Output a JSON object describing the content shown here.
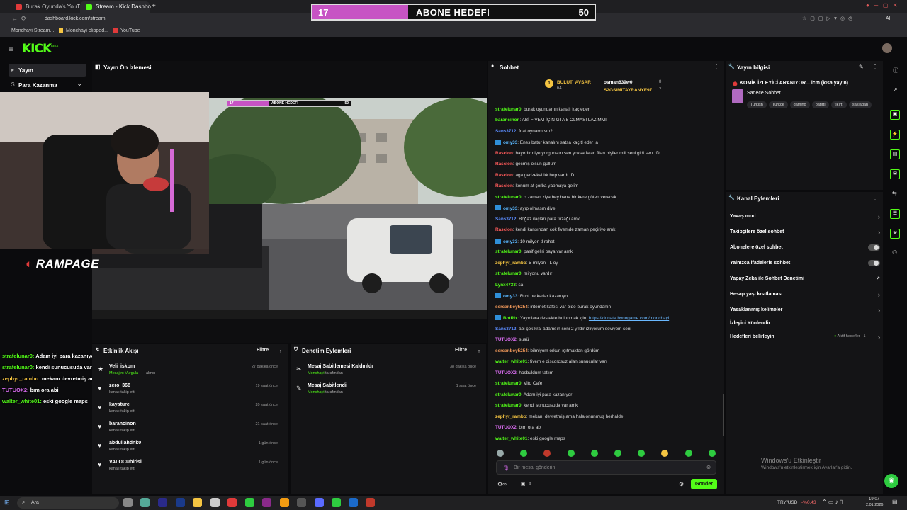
{
  "browser": {
    "tabs": [
      {
        "label": "Burak Oyunda's YouTube",
        "color": "#e03a3a"
      },
      {
        "label": "Stream - Kick Dashbo",
        "color": "#53fc18"
      }
    ],
    "new_tab": "+",
    "url": "dashboard.kick.com/stream",
    "bookmarks": [
      "Monchayi Stream...",
      "Monchayi clipped...",
      "YouTube"
    ],
    "ai_label": "AI"
  },
  "goal": {
    "current": "17",
    "label": "ABONE HEDEFI",
    "target": "50",
    "progress": 0.34,
    "color": "#c753c4"
  },
  "kick": {
    "logo": "KICK",
    "beta": "BETA"
  },
  "leftnav": {
    "items": [
      {
        "label": "Yayın"
      },
      {
        "label": "Para Kazanma"
      }
    ]
  },
  "preview": {
    "title": "Yayın Ön İzlemesi",
    "inner_goal": {
      "current": "17",
      "label": "ABONE HEDEFI",
      "target": "50"
    },
    "overlay_logo": "RAMPAGE",
    "overlay_chat": [
      {
        "user": "strafelunar0:",
        "msg": "Adam iyi para kazanıyor",
        "color": "#53fc18"
      },
      {
        "user": "strafelunar0:",
        "msg": "kendi sunucusuda var amk",
        "color": "#53fc18"
      },
      {
        "user": "zephyr_rambo:",
        "msg": "mekanı devretmiş ama hala onunmuş herhalde",
        "color": "#f5c542"
      },
      {
        "user": "TUTUOX2:",
        "msg": "bım ora abi",
        "color": "#d96cf0"
      },
      {
        "user": "walter_white01:",
        "msg": "eski google maps",
        "color": "#53fc18"
      }
    ]
  },
  "activity": {
    "title": "Etkinlik Akışı",
    "filter": "Filtre",
    "events": [
      {
        "name": "Veli_iskom",
        "sub": "Mesajını Vurgula",
        "sub2": "almdı",
        "time": "27 dakika önce"
      },
      {
        "name": "zero_368",
        "sub": "kanalı takip etti",
        "time": "19 saat önce"
      },
      {
        "name": "kayature",
        "sub": "kanalı takip etti",
        "time": "20 saat önce"
      },
      {
        "name": "barancinon",
        "sub": "kanalı takip etti",
        "time": "21 saat önce"
      },
      {
        "name": "abdullahdnk0",
        "sub": "kanalı takip etti",
        "time": "1 gün önce"
      },
      {
        "name": "VALOCUbirisi",
        "sub": "kanalı takip etti",
        "time": "1 gün önce"
      }
    ]
  },
  "moderation": {
    "title": "Denetim Eylemleri",
    "filter": "Filtre",
    "actions": [
      {
        "title": "Mesaj Sabitlemesi Kaldırıldı",
        "by": "Monchayi",
        "by_suffix": "tarafından",
        "time": "38 dakika önce"
      },
      {
        "title": "Mesaj Sabitlendi",
        "by": "Monchayi",
        "by_suffix": "tarafından",
        "time": "1 saat önce"
      }
    ]
  },
  "chat": {
    "title": "Sohbet",
    "top_users": [
      {
        "name": "BULUT_AVSAR",
        "count": "64"
      },
      {
        "name": "osman639w0",
        "count": "8"
      },
      {
        "name": "S2GSIMITAYRANYE97",
        "count": "7"
      }
    ],
    "messages": [
      {
        "user": "strafelunar0",
        "text": "burak oyundanın kanalı kaç eder",
        "color": "#53fc18"
      },
      {
        "user": "barancinon",
        "text": "ABİ FİVEM İÇİN GTA 5 OLMASI LAZIMMI",
        "color": "#53fc18"
      },
      {
        "user": "Sans3712",
        "text": "fnaf oynarmısın?",
        "color": "#5b8cff"
      },
      {
        "user": "omy33",
        "text": "Enes batur kanalını satsa kaç tl eder la",
        "color": "#5bb8ff",
        "badge": true
      },
      {
        "user": "Rasclon",
        "text": "hayırdır niye yorgunsun sen yoksa falan filan bişiler mili seni gidi seni :D",
        "color": "#ff5b5b"
      },
      {
        "user": "Rasclon",
        "text": "geçmiş olsun güllüm",
        "color": "#ff5b5b"
      },
      {
        "user": "Rasclon",
        "text": "aga gerizekalılık hep vardı :D",
        "color": "#ff5b5b"
      },
      {
        "user": "Rasclon",
        "text": "konum at çorba yapmaya gelim",
        "color": "#ff5b5b"
      },
      {
        "user": "strafelunar0",
        "text": "o zaman ziya bey bana bir kere göten verecek",
        "color": "#53fc18"
      },
      {
        "user": "omy33",
        "text": "ayıp olmasın diye",
        "color": "#5bb8ff",
        "badge": true
      },
      {
        "user": "Sans3712",
        "text": "Boğaz ilaçları para tuzağı amk",
        "color": "#5b8cff"
      },
      {
        "user": "Rasclon",
        "text": "kendi kansından cok fivemde zaman geçiriyo amk",
        "color": "#ff5b5b"
      },
      {
        "user": "omy33",
        "text": "10 milyon tl rahat",
        "color": "#5bb8ff",
        "badge": true
      },
      {
        "user": "strafelunar0",
        "text": "pasif geliri baya var amk",
        "color": "#53fc18"
      },
      {
        "user": "zephyr_rambo",
        "text": "5 milyon TL oy",
        "color": "#f5c542"
      },
      {
        "user": "strafelunar0",
        "text": "milyonu vardır",
        "color": "#53fc18"
      },
      {
        "user": "Lynx4733",
        "text": "sa",
        "color": "#53fc18"
      },
      {
        "user": "omy33",
        "text": "Ruhi ne kadar kazanıyo",
        "color": "#5bb8ff",
        "badge": true
      },
      {
        "user": "sercanbey5254",
        "text": "internet kafesi var bide burak oyundanın",
        "color": "#f29a5b"
      },
      {
        "user": "BotRix",
        "text": "Yayınlara destekte bulunmak için: ",
        "link": "https://donate.bynogame.com/monchayi",
        "color": "#53fc18",
        "badge": true
      },
      {
        "user": "Sans3712",
        "text": "abi çok kral adamsın seni 2 yıldır izliyorum seviyom seni",
        "color": "#5b8cff"
      },
      {
        "user": "TUTUOX2",
        "text": "suaü",
        "color": "#d96cf0"
      },
      {
        "user": "sercanbey5254",
        "text": "bilmiyom orkun ışıtmaktan gördüm",
        "color": "#f29a5b"
      },
      {
        "user": "walter_white01",
        "text": "fivem e discordsuz alan sunucular varı",
        "color": "#53fc18"
      },
      {
        "user": "TUTUOX2",
        "text": "hosbuldum tatlım",
        "color": "#d96cf0"
      },
      {
        "user": "strafelunar0",
        "text": "Vito Cafe",
        "color": "#53fc18"
      },
      {
        "user": "strafelunar0",
        "text": "Adam iyi para kazanıyor",
        "color": "#53fc18"
      },
      {
        "user": "strafelunar0",
        "text": "kendi sunucusuda var amk",
        "color": "#53fc18"
      },
      {
        "user": "zephyr_rambo",
        "text": "mekanı devretmiş ama hala onunmuş herhalde",
        "color": "#f5c542"
      },
      {
        "user": "TUTUOX2",
        "text": "bım ora abi",
        "color": "#d96cf0"
      },
      {
        "user": "walter_white01",
        "text": "eski google maps",
        "color": "#53fc18"
      }
    ],
    "input_placeholder": "Bir mesaj gönderin",
    "count": "0",
    "send_label": "Gönder"
  },
  "stream_info": {
    "title": "Yayın bilgisi",
    "stream_title": "KOMİK İZLEYİCİ ARANIYOR... lcm (kısa yayın)",
    "category": "Sadece Sohbet",
    "tags": [
      "Turkish",
      "Türkçe",
      "gaming",
      "patırtı",
      "tıkırtı",
      "şakladan"
    ]
  },
  "channel_actions": {
    "title": "Kanal Eylemleri",
    "items": [
      {
        "label": "Yavaş mod",
        "control": "chevron"
      },
      {
        "label": "Takipçilere özel sohbet",
        "control": "chevron"
      },
      {
        "label": "Abonelere özel sohbet",
        "control": "toggle"
      },
      {
        "label": "Yalnızca ifadelerle sohbet",
        "control": "toggle"
      },
      {
        "label": "Yapay Zeka ile Sohbet Denetimi",
        "control": "link"
      },
      {
        "label": "Hesap yaşı kısıtlaması",
        "control": "chevron"
      },
      {
        "label": "Yasaklanmış kelimeler",
        "control": "chevron"
      },
      {
        "label": "İzleyici Yönlendir",
        "control": "none"
      },
      {
        "label": "Hedefleri belirleyin",
        "control": "chevron"
      }
    ],
    "goals_note": "Aktif hedefler - 1"
  },
  "windows_watermark": {
    "line1": "Windows'u Etkinleştir",
    "line2": "Windows'u etkinleştirmek için Ayarlar'a gidin."
  },
  "taskbar": {
    "search_placeholder": "Ara",
    "currency": "TRY/USD",
    "currency_change": "-%0.43",
    "time": "19:07",
    "date": "2.01.2026"
  }
}
